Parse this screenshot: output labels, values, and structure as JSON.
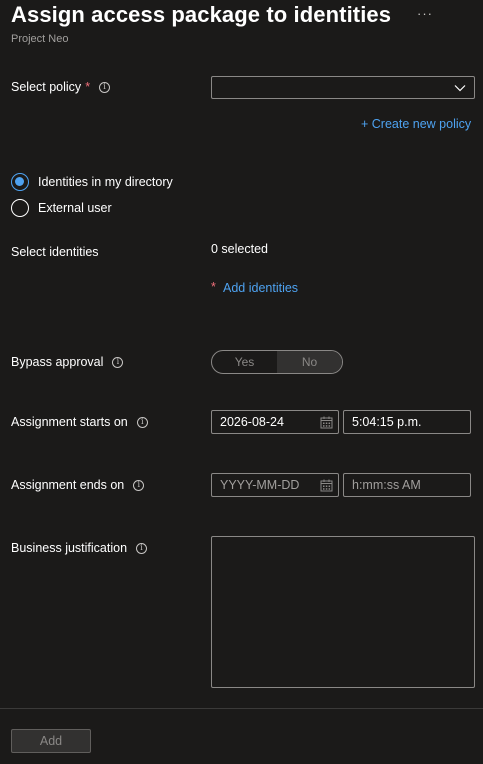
{
  "header": {
    "title": "Assign access package to identities",
    "more_label": "···",
    "subtitle": "Project Neo"
  },
  "policy": {
    "label": "Select policy",
    "required_mark": "*",
    "selected_value": "",
    "create_link": "+ Create new policy"
  },
  "identity_type": {
    "options": [
      {
        "label": "Identities in my directory",
        "checked": true
      },
      {
        "label": "External user",
        "checked": false
      }
    ]
  },
  "select_identities": {
    "label": "Select identities",
    "count_text": "0 selected",
    "required_mark": "*",
    "add_link": "Add identities"
  },
  "bypass_approval": {
    "label": "Bypass approval",
    "options": [
      "Yes",
      "No"
    ],
    "selected": "No"
  },
  "assignment_start": {
    "label": "Assignment starts on",
    "date_value": "2026-08-24",
    "time_value": "5:04:15 p.m."
  },
  "assignment_end": {
    "label": "Assignment ends on",
    "date_placeholder": "YYYY-MM-DD",
    "time_placeholder": "h:mm:ss AM"
  },
  "justification": {
    "label": "Business justification",
    "value": ""
  },
  "footer": {
    "add_label": "Add"
  },
  "info_glyph": "i",
  "colors": {
    "background": "#1b1a19",
    "link": "#4ea2f0",
    "required": "#f1707b",
    "border": "#8a8886"
  }
}
